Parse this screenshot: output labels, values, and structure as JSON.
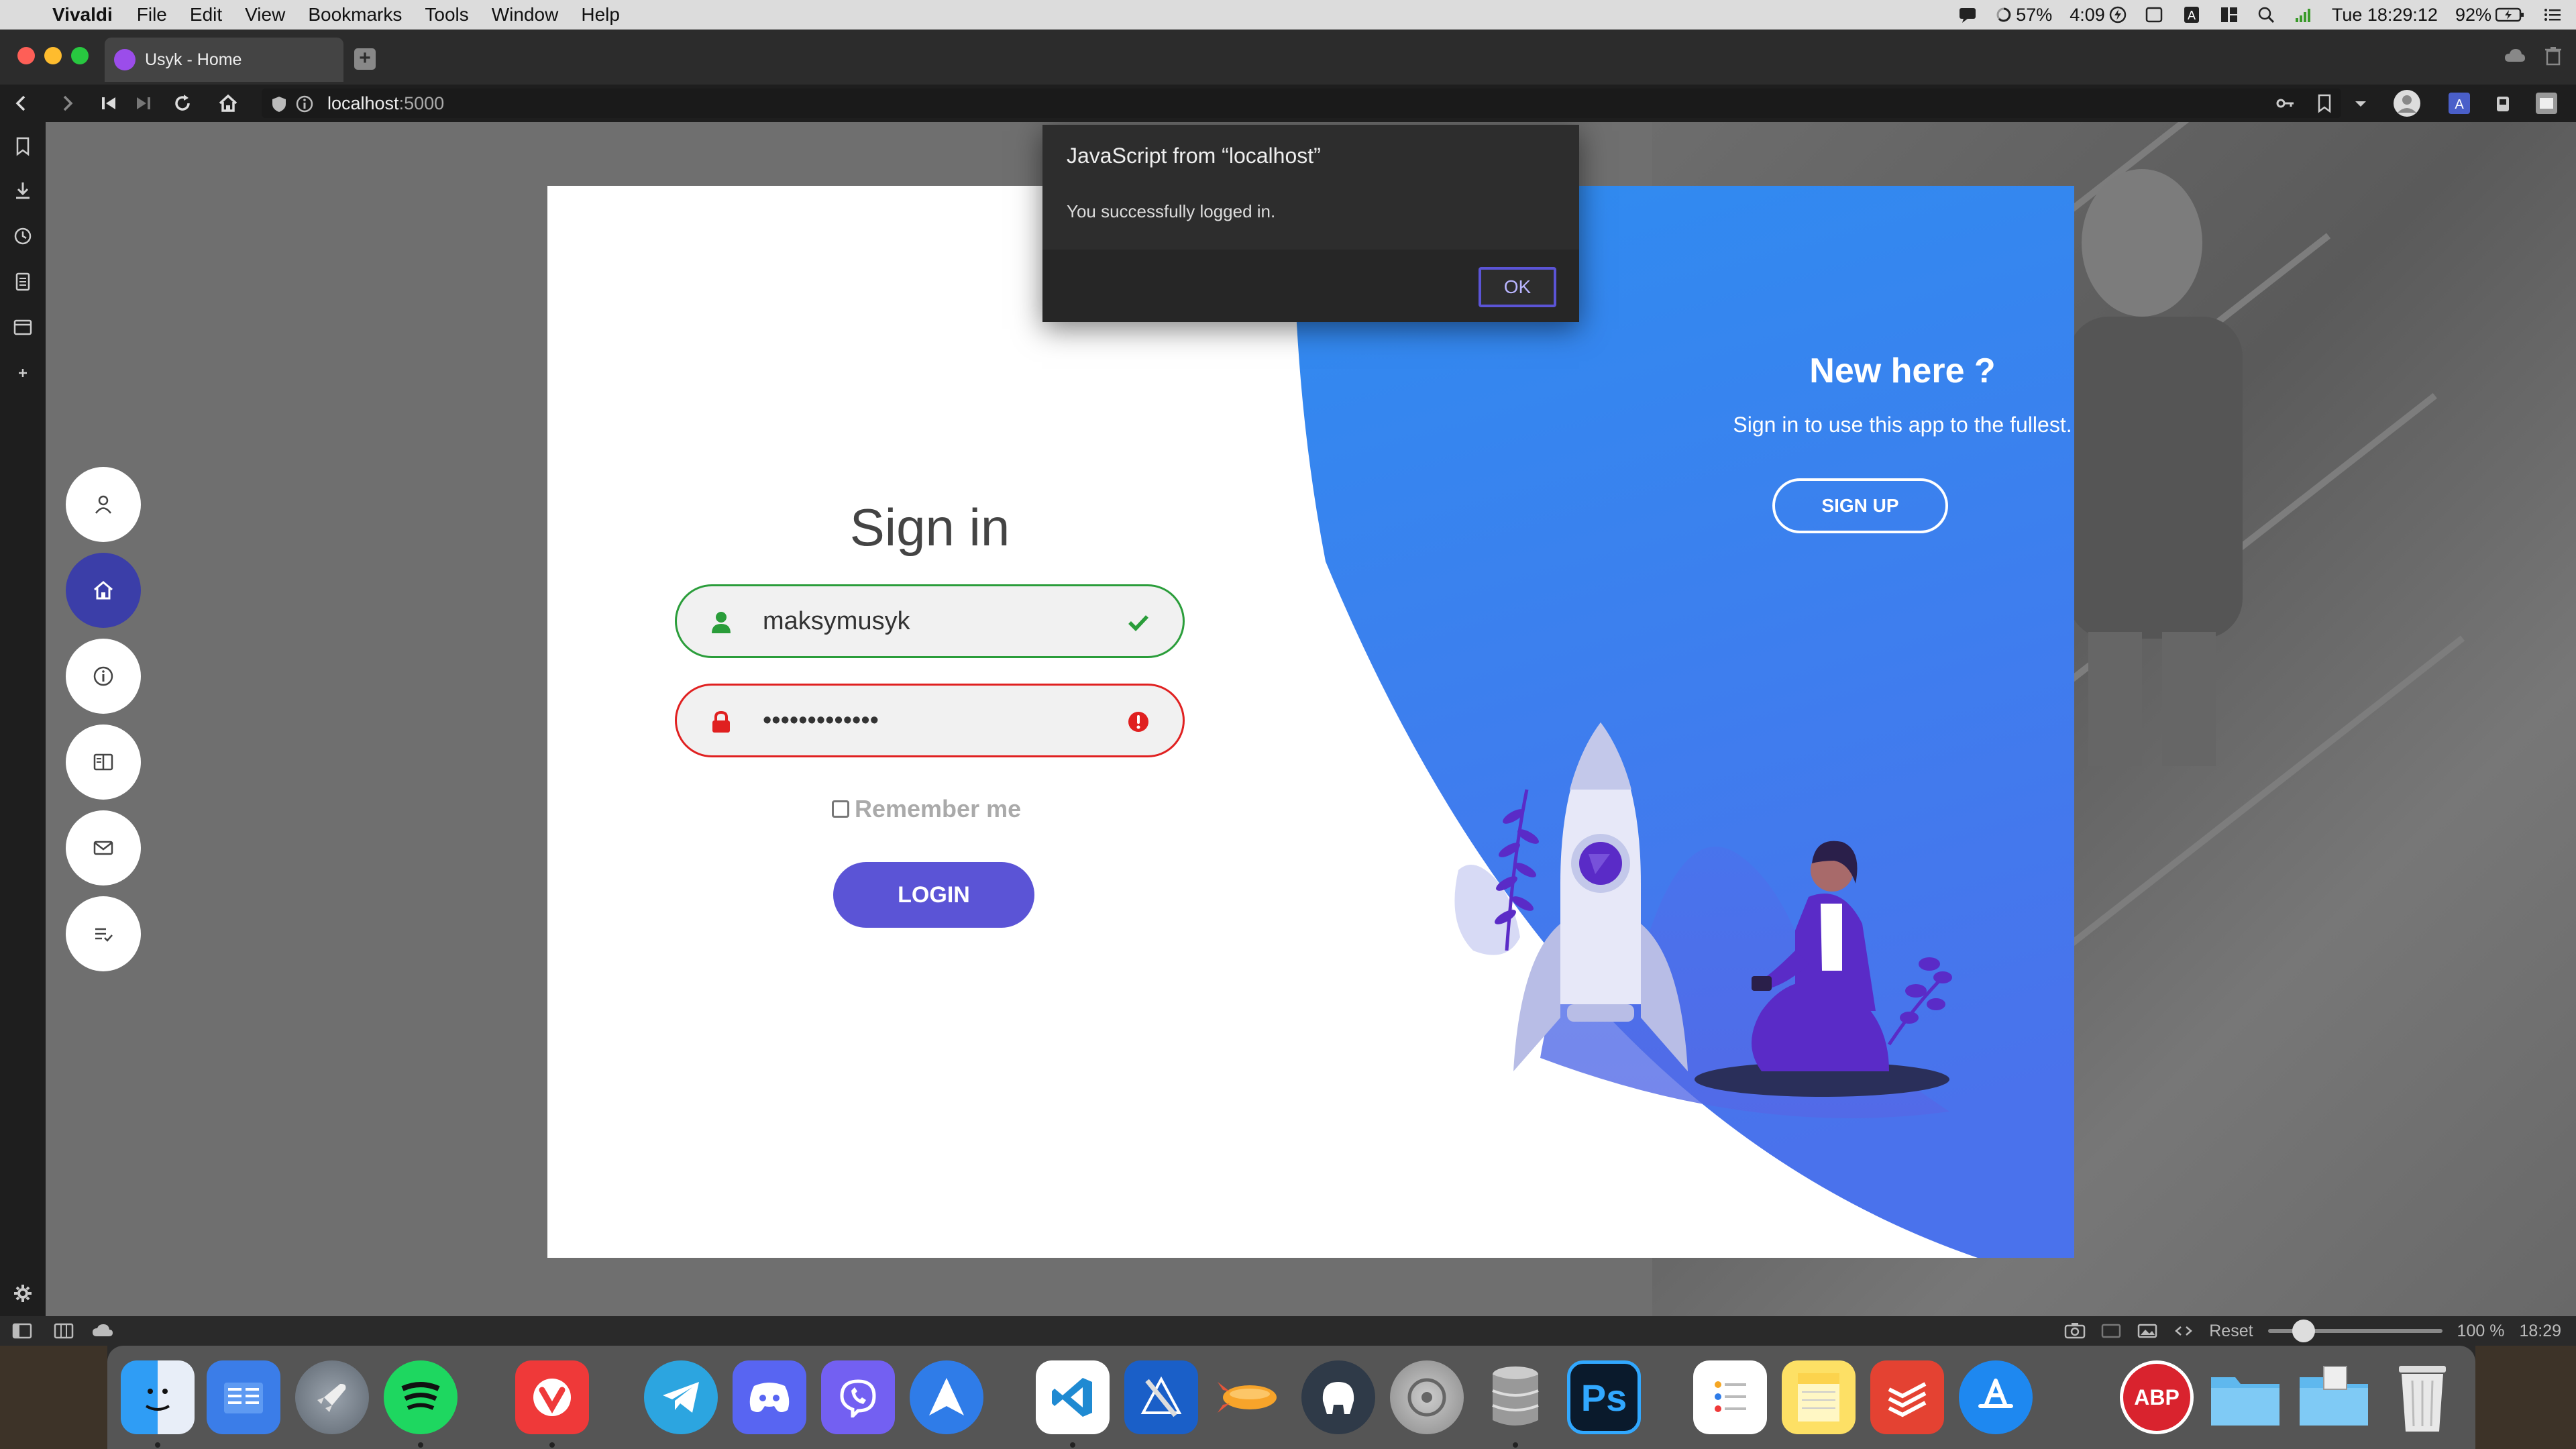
{
  "menubar": {
    "app_name": "Vivaldi",
    "items": [
      "File",
      "Edit",
      "View",
      "Bookmarks",
      "Tools",
      "Window",
      "Help"
    ],
    "battery_small": "57%",
    "timer": "4:09",
    "datetime": "Tue 18:29:12",
    "battery": "92%"
  },
  "tab": {
    "title": "Usyk - Home"
  },
  "address": {
    "host": "localhost",
    "port": ":5000"
  },
  "page": {
    "signin_title": "Sign in",
    "username_value": "maksymusyk",
    "password_value": "•••••••••••••",
    "remember_label": "Remember me",
    "login_label": "LOGIN",
    "newhere_title": "New here ?",
    "newhere_sub": "Sign in to use this app to the fullest.",
    "signup_label": "SIGN UP"
  },
  "dialog": {
    "title": "JavaScript from “localhost”",
    "message": "You successfully logged in.",
    "ok_label": "OK"
  },
  "statusbar": {
    "reset": "Reset",
    "zoom": "100 %",
    "time": "18:29"
  },
  "dock": {
    "ps_label": "Ps",
    "abp_label": "ABP"
  },
  "colors": {
    "accent_purple": "#5b54d6",
    "nav_active": "#3b3ea8",
    "valid_green": "#2a9d3a",
    "error_red": "#e02020",
    "panel_blue": "#2f8cf0"
  }
}
